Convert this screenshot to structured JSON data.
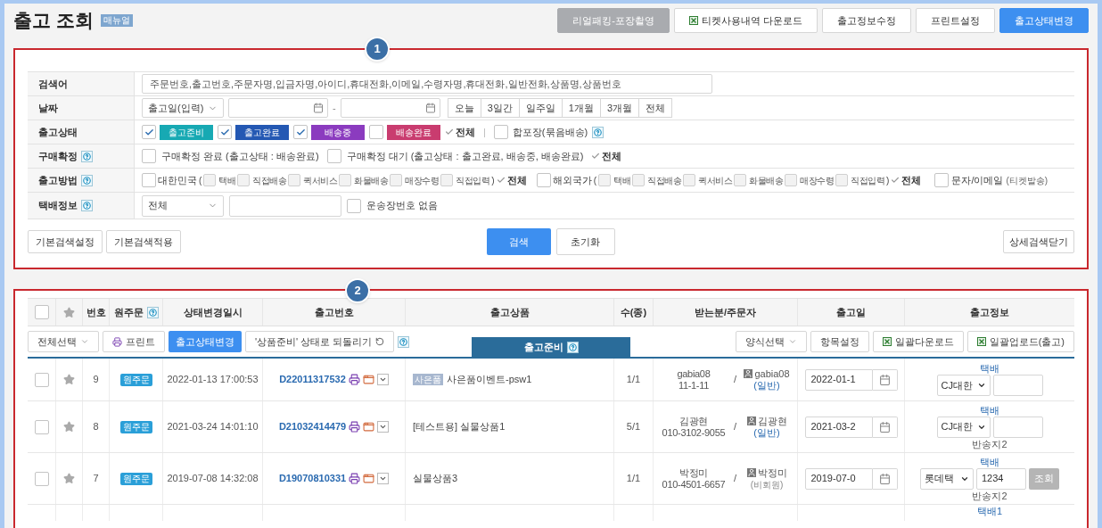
{
  "header": {
    "title": "출고 조회",
    "manual_badge": "매뉴얼",
    "buttons": [
      {
        "label": "리얼패킹-포장촬영",
        "kind": "disabled"
      },
      {
        "label": "티켓사용내역 다운로드",
        "kind": "excel"
      },
      {
        "label": "출고정보수정",
        "kind": "plain"
      },
      {
        "label": "프린트설정",
        "kind": "plain"
      },
      {
        "label": "출고상태변경",
        "kind": "primary"
      }
    ]
  },
  "search": {
    "marker": "1",
    "keyword": {
      "label": "검색어",
      "help": false,
      "placeholder": "주문번호,출고번호,주문자명,입금자명,아이디,휴대전화,이메일,수령자명,휴대전화,일반전화,상품명,상품번호"
    },
    "date": {
      "label": "날짜",
      "help": false,
      "type_select": "출고일(입력)",
      "separator": "-",
      "ranges": [
        "오늘",
        "3일간",
        "일주일",
        "1개월",
        "3개월",
        "전체"
      ]
    },
    "status": {
      "label": "출고상태",
      "help": false,
      "items": [
        {
          "label": "출고준비",
          "checked": true,
          "color": "#17a9b3"
        },
        {
          "label": "출고완료",
          "checked": true,
          "color": "#2458b3"
        },
        {
          "label": "배송중",
          "checked": true,
          "color": "#8b3bbf"
        },
        {
          "label": "배송완료",
          "checked": false,
          "color": "#c93c6f"
        }
      ],
      "all": "전체",
      "separator": "|",
      "bundle": {
        "label": "합포장(묶음배송)",
        "checked": false,
        "help": true
      }
    },
    "purchase": {
      "label": "구매확정",
      "help": true,
      "options": [
        {
          "label": "구매확정 완료 (출고상태 : 배송완료)",
          "checked": false
        },
        {
          "label": "구매확정 대기 (출고상태 : 출고완료, 배송중, 배송완료)",
          "checked": false
        }
      ],
      "all": "전체"
    },
    "method": {
      "label": "출고방법",
      "help": true,
      "groups": [
        {
          "label": "대한민국",
          "checked": false,
          "open": "(",
          "close": ")",
          "all": "전체",
          "options": [
            {
              "label": "택배",
              "checked": false
            },
            {
              "label": "직접배송",
              "checked": false
            },
            {
              "label": "퀵서비스",
              "checked": false
            },
            {
              "label": "화물배송",
              "checked": false
            },
            {
              "label": "매장수령",
              "checked": false
            },
            {
              "label": "직접입력",
              "checked": false
            }
          ]
        },
        {
          "label": "해외국가",
          "checked": false,
          "open": "(",
          "close": ")",
          "all": "전체",
          "options": [
            {
              "label": "택배",
              "checked": false
            },
            {
              "label": "직접배송",
              "checked": false
            },
            {
              "label": "퀵서비스",
              "checked": false
            },
            {
              "label": "화물배송",
              "checked": false
            },
            {
              "label": "매장수령",
              "checked": false
            },
            {
              "label": "직접입력",
              "checked": false
            }
          ]
        }
      ],
      "message": {
        "label": "문자/이메일",
        "note": "(티켓발송)",
        "checked": false
      }
    },
    "courier": {
      "label": "택배정보",
      "help": true,
      "select": "전체",
      "no_invoice": {
        "label": "운송장번호 없음",
        "checked": false
      }
    },
    "left_buttons": [
      "기본검색설정",
      "기본검색적용"
    ],
    "search_button": "검색",
    "reset_button": "초기화",
    "close_button": "상세검색닫기"
  },
  "list": {
    "marker": "2",
    "header_checkbox": {
      "checked": false
    },
    "columns": [
      {
        "label": "번호",
        "help": false
      },
      {
        "label": "원주문",
        "help": true
      },
      {
        "label": "상태변경일시",
        "help": false
      },
      {
        "label": "출고번호",
        "help": false
      },
      {
        "label": "출고상품",
        "help": false
      },
      {
        "label": "수(종)",
        "help": false
      },
      {
        "label": "받는분/주문자",
        "help": false
      },
      {
        "label": "출고일",
        "help": false
      },
      {
        "label": "출고정보",
        "help": false
      }
    ],
    "toolbar": {
      "select_all": "전체선택",
      "print": "프린트",
      "change_status": "출고상태변경",
      "revert": "'상품준비' 상태로 되돌리기",
      "tab": {
        "label": "출고준비",
        "selected": true
      },
      "form_select": "양식선택",
      "columns_setting": "항목설정",
      "bulk_download": "일괄다운로드",
      "bulk_upload": "일괄업로드(출고)"
    },
    "rows": [
      {
        "kind": "full",
        "checked": false,
        "starred": false,
        "number": "9",
        "original": "원주문",
        "changed_at": "2022-01-13 17:00:53",
        "shipment_no": "D22011317532",
        "product_tag": "사은품",
        "product": "사은품이벤트-psw1",
        "qty": "1/1",
        "recipient": "gabia08",
        "recipient_phone": "11-1-11",
        "separator": "/",
        "orderer": "gabia08",
        "orderer_type": "(일반)",
        "member": true,
        "ship_date": "2022-01-1",
        "delivery": "택배",
        "courier": "CJ대한",
        "invoice": ""
      },
      {
        "kind": "full",
        "checked": false,
        "starred": false,
        "number": "8",
        "original": "원주문",
        "changed_at": "2021-03-24 14:01:10",
        "shipment_no": "D21032414479",
        "product": "[테스트용] 실물상품1",
        "qty": "5/1",
        "recipient": "김광현",
        "recipient_phone": "010-3102-9055",
        "separator": "/",
        "orderer": "김광현",
        "orderer_type": "(일반)",
        "member": true,
        "ship_date": "2021-03-2",
        "delivery": "택배",
        "courier": "CJ대한",
        "invoice": "",
        "return_addr": "반송지2"
      },
      {
        "kind": "full",
        "checked": false,
        "starred": false,
        "number": "7",
        "original": "원주문",
        "changed_at": "2019-07-08 14:32:08",
        "shipment_no": "D19070810331",
        "product": "실물상품3",
        "qty": "1/1",
        "recipient": "박정미",
        "recipient_phone": "010-4501-6657",
        "separator": "/",
        "orderer": "박정미",
        "orderer_type": "(비회원)",
        "member": false,
        "ship_date": "2019-07-0",
        "delivery": "택배",
        "courier": "롯데택",
        "invoice": "1234",
        "lookup": "조회",
        "return_addr": "반송지2"
      },
      {
        "kind": "partial",
        "delivery": "택배1"
      }
    ]
  }
}
